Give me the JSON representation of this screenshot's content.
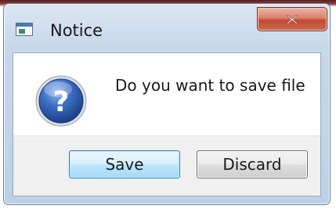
{
  "window": {
    "title": "Notice",
    "app_icon": "window-app-icon",
    "close_icon": "close-icon"
  },
  "dialog": {
    "icon": "question-icon",
    "icon_glyph": "?",
    "message": "Do you want to save file"
  },
  "buttons": {
    "save_label": "Save",
    "discard_label": "Discard"
  },
  "colors": {
    "close_button": "#c24a31",
    "question_icon": "#2f5fb0",
    "default_button_border": "#3c7fb1"
  }
}
